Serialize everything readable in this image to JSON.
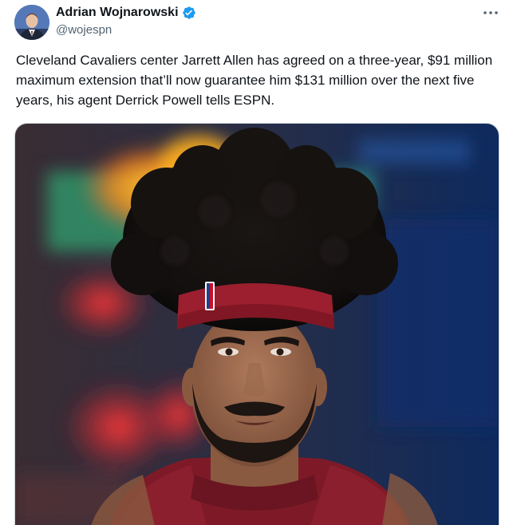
{
  "author": {
    "name": "Adrian Wojnarowski",
    "handle": "@wojespn",
    "verified_icon": "verified-badge-icon",
    "verified_color": "#1d9bf0"
  },
  "menu": {
    "icon": "more-horizontal-icon"
  },
  "tweet": {
    "text": "Cleveland Cavaliers center Jarrett Allen has agreed on a three-year, $91 million maximum extension that’ll now guarantee him $131 million over the next five years, his agent Derrick Powell tells ESPN."
  },
  "media": {
    "jersey_color": "#8b1c2c",
    "headband_color": "#9b1f2e"
  }
}
